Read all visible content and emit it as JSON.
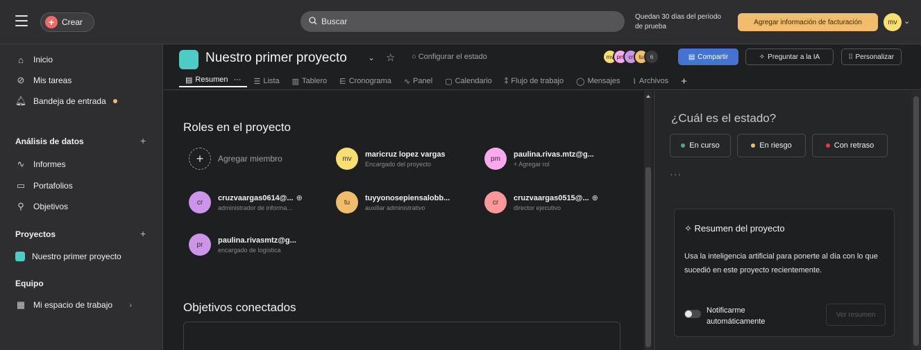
{
  "topbar": {
    "create_label": "Crear",
    "search_placeholder": "Buscar",
    "trial_text": "Quedan 30 días del período de prueba",
    "billing_button": "Agregar información de facturación",
    "user_initials": "mv"
  },
  "sidebar": {
    "items": [
      {
        "label": "Inicio",
        "icon": "home-icon"
      },
      {
        "label": "Mis tareas",
        "icon": "check-circle-icon"
      },
      {
        "label": "Bandeja de entrada",
        "icon": "bell-icon"
      }
    ],
    "analysis_header": "Análisis de datos",
    "analysis_items": [
      {
        "label": "Informes",
        "icon": "chart-line-icon"
      },
      {
        "label": "Portafolios",
        "icon": "folder-icon"
      },
      {
        "label": "Objetivos",
        "icon": "person-icon"
      }
    ],
    "projects_header": "Proyectos",
    "project_item": "Nuestro primer proyecto",
    "team_header": "Equipo",
    "team_item": "Mi espacio de trabajo"
  },
  "project": {
    "title": "Nuestro primer proyecto",
    "configure_status": "Configurar el estado",
    "facepile": [
      "mv",
      "pm",
      "cr",
      "tu"
    ],
    "facepile_more": "6",
    "share_label": "Compartir",
    "ask_ai_label": "Preguntar a la IA",
    "customize_label": "Personalizar",
    "tabs": [
      "Resumen",
      "Lista",
      "Tablero",
      "Cronograma",
      "Panel",
      "Calendario",
      "Flujo de trabajo",
      "Mensajes",
      "Archivos"
    ]
  },
  "roles": {
    "title": "Roles en el proyecto",
    "add_member": "Agregar miembro",
    "members": [
      {
        "initials": "mv",
        "name": "maricruz lopez vargas",
        "role": "Encargado del proyecto",
        "color": "#f8df72"
      },
      {
        "initials": "pm",
        "name": "paulina.rivas.mtz@g...",
        "role": "+ Agregar rol",
        "color": "#f9aaef"
      },
      {
        "initials": "cr",
        "name": "cruzvaargas0614@...",
        "role": "administrador de informa...",
        "color": "#cd95ea"
      },
      {
        "initials": "tu",
        "name": "tuyyonosepiensalobb...",
        "role": "auxiliar administrativo",
        "color": "#f1bd6c"
      },
      {
        "initials": "cr",
        "name": "cruzvaargas0515@...",
        "role": "director ejecutivo",
        "color": "#fc979a"
      },
      {
        "initials": "pr",
        "name": "paulina.rivasmtz@g...",
        "role": "encargado de logística",
        "color": "#cd95ea"
      }
    ]
  },
  "goals": {
    "title": "Objetivos conectados"
  },
  "status_panel": {
    "title": "¿Cuál es el estado?",
    "buttons": [
      {
        "label": "En curso",
        "color": "#5da283"
      },
      {
        "label": "En riesgo",
        "color": "#f1bd6c"
      },
      {
        "label": "Con retraso",
        "color": "#e8384f"
      }
    ],
    "summary_title": "Resumen del proyecto",
    "summary_desc": "Usa la inteligencia artificial para ponerte al día con lo que sucedió en este proyecto recientemente.",
    "notify_label": "Notificarme automáticamente",
    "view_summary": "Ver resumen"
  }
}
